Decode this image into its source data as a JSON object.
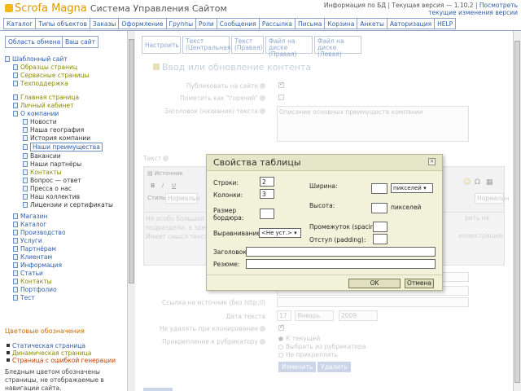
{
  "header": {
    "brand": "Scrofa Magna",
    "subtitle": "Система Управления Сайтом",
    "version_text": "Информация по БД | Текущая версия — 1.10.2 | ",
    "version_link": "Посмотреть текущие изменения версии"
  },
  "menu": [
    "Каталог",
    "Типы объектов",
    "Заказы",
    "Оформление",
    "Группы",
    "Роли",
    "Сообщения",
    "Рассылка",
    "Письма",
    "Корзина",
    "Анкеты",
    "Авторизация",
    "HELP"
  ],
  "sidebar": {
    "buttons": [
      "Область обмена",
      "Ваш сайт"
    ],
    "tree": [
      {
        "label": "Шаблонный сайт",
        "color": "#2f5da8"
      },
      {
        "label": "Образцы страниц",
        "color": "#8a8a00"
      },
      {
        "label": "Сервисные страницы",
        "color": "#8a8a00"
      },
      {
        "label": "Техподдержка",
        "color": "#8a8a00"
      },
      {
        "label": "Главная страница",
        "color": "#8a8a00"
      },
      {
        "label": "Личный кабинет",
        "color": "#8a8a00"
      },
      {
        "label": "О компании",
        "color": "#2f5da8"
      },
      {
        "label": "Новости",
        "color": "#333333"
      },
      {
        "label": "Наша география",
        "color": "#333333"
      },
      {
        "label": "История компании",
        "color": "#333333"
      },
      {
        "label": "Наши преимущества",
        "color": "#2f5da8"
      },
      {
        "label": "Вакансии",
        "color": "#333333"
      },
      {
        "label": "Наши партнёры",
        "color": "#333333"
      },
      {
        "label": "Контакты",
        "color": "#8a8a00"
      },
      {
        "label": "Вопрос — ответ",
        "color": "#333333"
      },
      {
        "label": "Пресса о нас",
        "color": "#333333"
      },
      {
        "label": "Наш коллектив",
        "color": "#333333"
      },
      {
        "label": "Лицензии и сертификаты",
        "color": "#333333"
      },
      {
        "label": "Магазин",
        "color": "#2f5da8"
      },
      {
        "label": "Каталог",
        "color": "#2f5da8"
      },
      {
        "label": "Производство",
        "color": "#2f5da8"
      },
      {
        "label": "Услуги",
        "color": "#2f5da8"
      },
      {
        "label": "Партнёрам",
        "color": "#2f5da8"
      },
      {
        "label": "Клиентам",
        "color": "#2f5da8"
      },
      {
        "label": "Информация",
        "color": "#2f5da8"
      },
      {
        "label": "Статьи",
        "color": "#2f5da8"
      },
      {
        "label": "Контакты",
        "color": "#8a8a00"
      },
      {
        "label": "Портфолио",
        "color": "#2f5da8"
      },
      {
        "label": "Тест",
        "color": "#2f5da8"
      }
    ],
    "legend_title": "Цветовые обозначения",
    "legend": [
      {
        "label": "Статическая страница",
        "color": "#2f5da8"
      },
      {
        "label": "Динамическая страница",
        "color": "#8a8a00"
      },
      {
        "label": "Страница с ошибкой генерации",
        "color": "#c03c00"
      }
    ],
    "note": "Бледным цветом обозначены страницы, не отображаемые в навигации сайта."
  },
  "tabs": [
    "Настроить",
    "Текст (Центральная)",
    "Текст (Правая)",
    "Файл на диске (Правая)",
    "Файл на диске (Левая)"
  ],
  "content": {
    "title": "Ввод или обновление контента",
    "publish_label": "Публиковать на сайте",
    "hot_label": "Пометить как \"горячий\"",
    "heading_label": "Заголовок (название) текста",
    "heading_value": "Описание основных преимуществ компании",
    "text_label": "Текст",
    "toolbar_source": "Источник",
    "toolbar_style": "Стиль",
    "toolbar_style_value": "Нормальн",
    "toolbar_font_value": "Нормальн",
    "editor_text_1": "Не особо большой ... подразделения ...",
    "editor_text_2": "подраздели, а здесь...",
    "editor_text_3": "Имеет смысл текст ...",
    "editor_text_right_1": "рать на",
    "editor_text_right_2": "иллюстрацию.",
    "source_link_label": "Ссылка на источник (без http://)",
    "date_label": "Дата текста",
    "date_day": "17",
    "date_month": "Январь",
    "date_year": "2009",
    "no_delete_label": "Не удалять при клонировании",
    "attach_label": "Прикрепление к рубрикатору",
    "radio_options": [
      "К текущей",
      "Выбрать из рубрикатора",
      "Не прикреплять"
    ],
    "btn_change": "Изменить",
    "btn_delete": "Удалить"
  },
  "dialog": {
    "title": "Свойства таблицы",
    "rows_label": "Строки:",
    "rows_value": "2",
    "cols_label": "Колонки:",
    "cols_value": "3",
    "border_label": "Размер бордюра:",
    "border_value": "",
    "align_label": "Выравнивание:",
    "align_value": "<Не уст.>",
    "width_label": "Ширина:",
    "width_unit": "пикселей",
    "height_label": "Высота:",
    "height_unit": "пикселей",
    "spacing_label": "Промежуток (spacing):",
    "padding_label": "Отступ (padding):",
    "caption_label": "Заголовок:",
    "summary_label": "Резюме:",
    "ok_label": "OK",
    "cancel_label": "Отмена"
  }
}
